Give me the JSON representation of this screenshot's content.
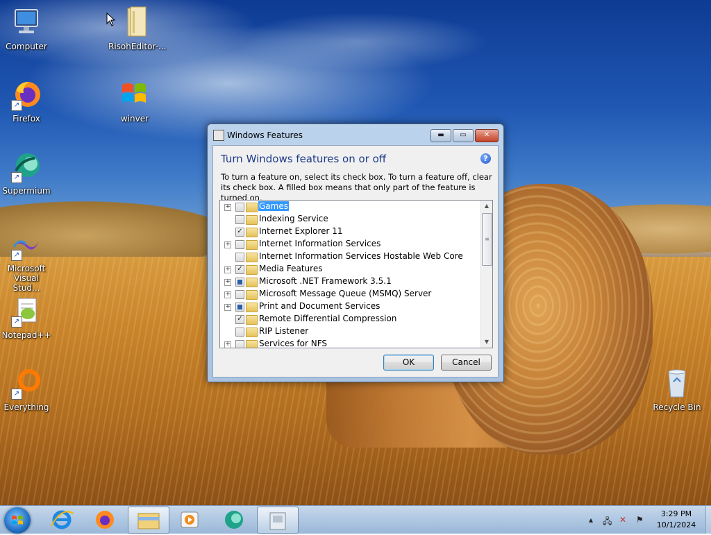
{
  "desktop": {
    "icons": [
      {
        "label": "Computer",
        "icon": "computer-icon"
      },
      {
        "label": "RisohEditor-...",
        "icon": "folder-icon"
      },
      {
        "label": "Firefox",
        "icon": "firefox-icon"
      },
      {
        "label": "winver",
        "icon": "windows-logo-icon"
      },
      {
        "label": "Supermium",
        "icon": "supermium-icon"
      },
      {
        "label": "Microsoft Visual Stud...",
        "icon": "visual-studio-icon"
      },
      {
        "label": "Notepad++",
        "icon": "notepadpp-icon"
      },
      {
        "label": "Everything",
        "icon": "everything-icon"
      },
      {
        "label": "Recycle Bin",
        "icon": "recycle-bin-icon"
      }
    ]
  },
  "dialog": {
    "title": "Windows Features",
    "heading": "Turn Windows features on or off",
    "help": "?",
    "description": "To turn a feature on, select its check box. To turn a feature off, clear its check box. A filled box means that only part of the feature is turned on.",
    "features": [
      {
        "label": "Games",
        "expandable": true,
        "state": "unchecked",
        "selected": true
      },
      {
        "label": "Indexing Service",
        "expandable": false,
        "state": "unchecked",
        "selected": false
      },
      {
        "label": "Internet Explorer 11",
        "expandable": false,
        "state": "checked",
        "selected": false
      },
      {
        "label": "Internet Information Services",
        "expandable": true,
        "state": "unchecked",
        "selected": false
      },
      {
        "label": "Internet Information Services Hostable Web Core",
        "expandable": false,
        "state": "unchecked",
        "selected": false
      },
      {
        "label": "Media Features",
        "expandable": true,
        "state": "checked",
        "selected": false
      },
      {
        "label": "Microsoft .NET Framework 3.5.1",
        "expandable": true,
        "state": "partial",
        "selected": false
      },
      {
        "label": "Microsoft Message Queue (MSMQ) Server",
        "expandable": true,
        "state": "unchecked",
        "selected": false
      },
      {
        "label": "Print and Document Services",
        "expandable": true,
        "state": "partial",
        "selected": false
      },
      {
        "label": "Remote Differential Compression",
        "expandable": false,
        "state": "checked",
        "selected": false
      },
      {
        "label": "RIP Listener",
        "expandable": false,
        "state": "unchecked",
        "selected": false
      },
      {
        "label": "Services for NFS",
        "expandable": true,
        "state": "unchecked",
        "selected": false
      }
    ],
    "ok_label": "OK",
    "cancel_label": "Cancel"
  },
  "taskbar": {
    "pinned": [
      {
        "name": "internet-explorer-icon"
      },
      {
        "name": "firefox-icon"
      },
      {
        "name": "file-explorer-icon"
      },
      {
        "name": "media-player-icon"
      },
      {
        "name": "supermium-icon"
      },
      {
        "name": "windows-features-icon"
      }
    ],
    "clock_time": "3:29 PM",
    "clock_date": "10/1/2024"
  },
  "colors": {
    "accent": "#3399ff",
    "heading": "#1e3b8a"
  }
}
